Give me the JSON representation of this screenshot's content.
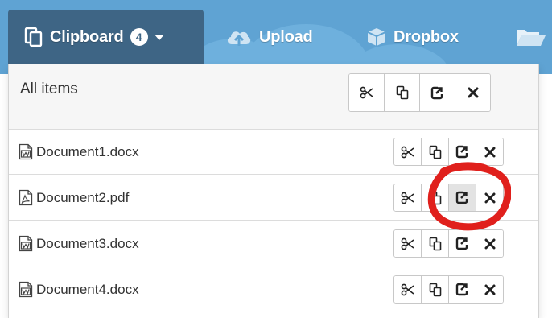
{
  "toolbar": {
    "clipboard_label": "Clipboard",
    "clipboard_count": "4",
    "upload_label": "Upload",
    "dropbox_label": "Dropbox"
  },
  "panel": {
    "title": "All items",
    "files": [
      {
        "name": "Document1.docx",
        "type": "word"
      },
      {
        "name": "Document2.pdf",
        "type": "pdf"
      },
      {
        "name": "Document3.docx",
        "type": "word"
      },
      {
        "name": "Document4.docx",
        "type": "word"
      }
    ],
    "actions": [
      "cut",
      "copy",
      "paste",
      "remove"
    ],
    "highlighted_row": 2,
    "highlighted_action": "paste"
  },
  "colors": {
    "toolbar_bg": "#5fa3d3",
    "active_tab_bg": "#3e6585",
    "annotation_red": "#e0201c"
  }
}
